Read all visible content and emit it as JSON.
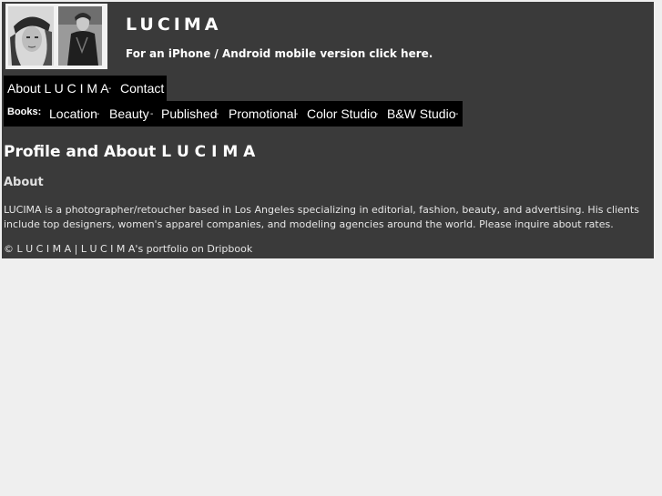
{
  "site": {
    "title": "LUCIMA",
    "mobile_text": "For an iPhone / Android mobile version click here."
  },
  "nav": {
    "main": [
      {
        "label": "About L U C I M A"
      },
      {
        "label": "Contact"
      }
    ],
    "separator": "-",
    "books_label": "Books:",
    "books": [
      {
        "label": "Location"
      },
      {
        "label": "Beauty"
      },
      {
        "label": "Published"
      },
      {
        "label": "Promotional"
      },
      {
        "label": "Color Studio"
      },
      {
        "label": "B&W Studio"
      }
    ]
  },
  "content": {
    "heading": "Profile and About L U C I M A",
    "subheading": "About",
    "body": "LUCIMA is a photographer/retoucher based in Los Angeles specializing in editorial, fashion, beauty, and advertising. His clients include top designers, women's apparel companies, and modeling agencies around the world. Please inquire about rates."
  },
  "footer": {
    "copyright": "© L U C I M A",
    "divider": "|",
    "portfolio_link": "L U C I M A's portfolio on Dripbook"
  },
  "colors": {
    "page_background": "#efefef",
    "content_background": "#3a3a3a",
    "nav_background": "#000000",
    "text": "#ffffff"
  }
}
